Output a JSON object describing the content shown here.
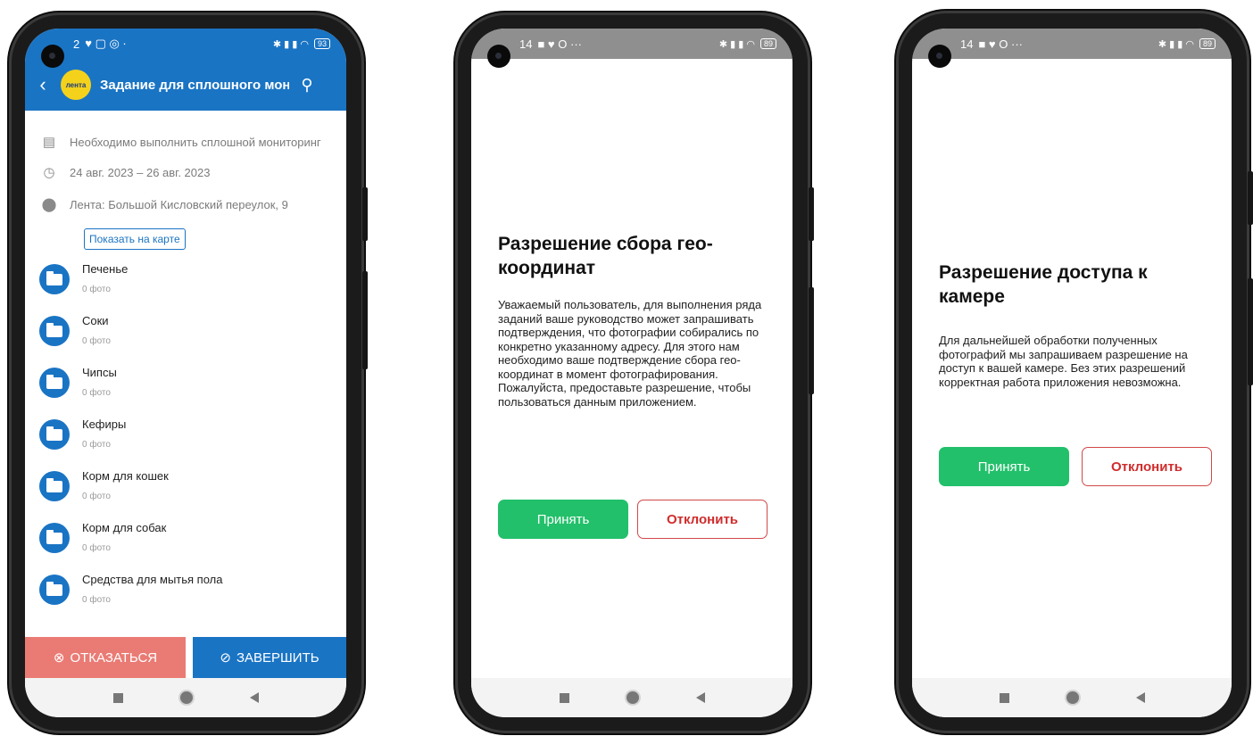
{
  "phone1": {
    "status": {
      "time": "2",
      "battery": "93"
    },
    "header": {
      "title": "Задание для сплошного мониторинга",
      "logo": "лента"
    },
    "info": {
      "description": "Необходимо выполнить сплошной мониторинг",
      "dates": "24 авг. 2023 – 26 авг. 2023",
      "address": "Лента: Большой Кисловский переулок, 9",
      "map_button": "Показать на карте"
    },
    "folders": [
      {
        "name": "Печенье",
        "count": "0 фото"
      },
      {
        "name": "Соки",
        "count": "0 фото"
      },
      {
        "name": "Чипсы",
        "count": "0 фото"
      },
      {
        "name": "Кефиры",
        "count": "0 фото"
      },
      {
        "name": "Корм для кошек",
        "count": "0 фото"
      },
      {
        "name": "Корм для собак",
        "count": "0 фото"
      },
      {
        "name": "Средства для мытья пола",
        "count": "0 фото"
      }
    ],
    "actions": {
      "refuse": "ОТКАЗАТЬСЯ",
      "finish": "ЗАВЕРШИТЬ"
    }
  },
  "phone2": {
    "status": {
      "time": "14",
      "battery": "89"
    },
    "dialog": {
      "title": "Разрешение сбора гео-координат",
      "text": "Уважаемый пользователь, для выполнения ряда заданий ваше руководство может запрашивать подтверждения, что фотографии собирались по конкретно указанному адресу. Для этого нам необходимо ваше подтверждение сбора гео-координат в момент фотографирования. Пожалуйста, предоставьте разрешение, чтобы пользоваться данным приложением.",
      "accept": "Принять",
      "decline": "Отклонить"
    }
  },
  "phone3": {
    "status": {
      "time": "14",
      "battery": "89"
    },
    "dialog": {
      "title": "Разрешение доступа к камере",
      "text": "Для дальнейшей обработки полученных фотографий мы запрашиваем разрешение на доступ к вашей камере. Без этих разрешений корректная работа приложения невозможна.",
      "accept": "Принять",
      "decline": "Отклонить"
    }
  },
  "colors": {
    "primary": "#1a74c4",
    "refuse": "#ea7b74",
    "accept": "#22c06a",
    "decline": "#d02c2c",
    "status_gray": "#8f8f8f"
  }
}
